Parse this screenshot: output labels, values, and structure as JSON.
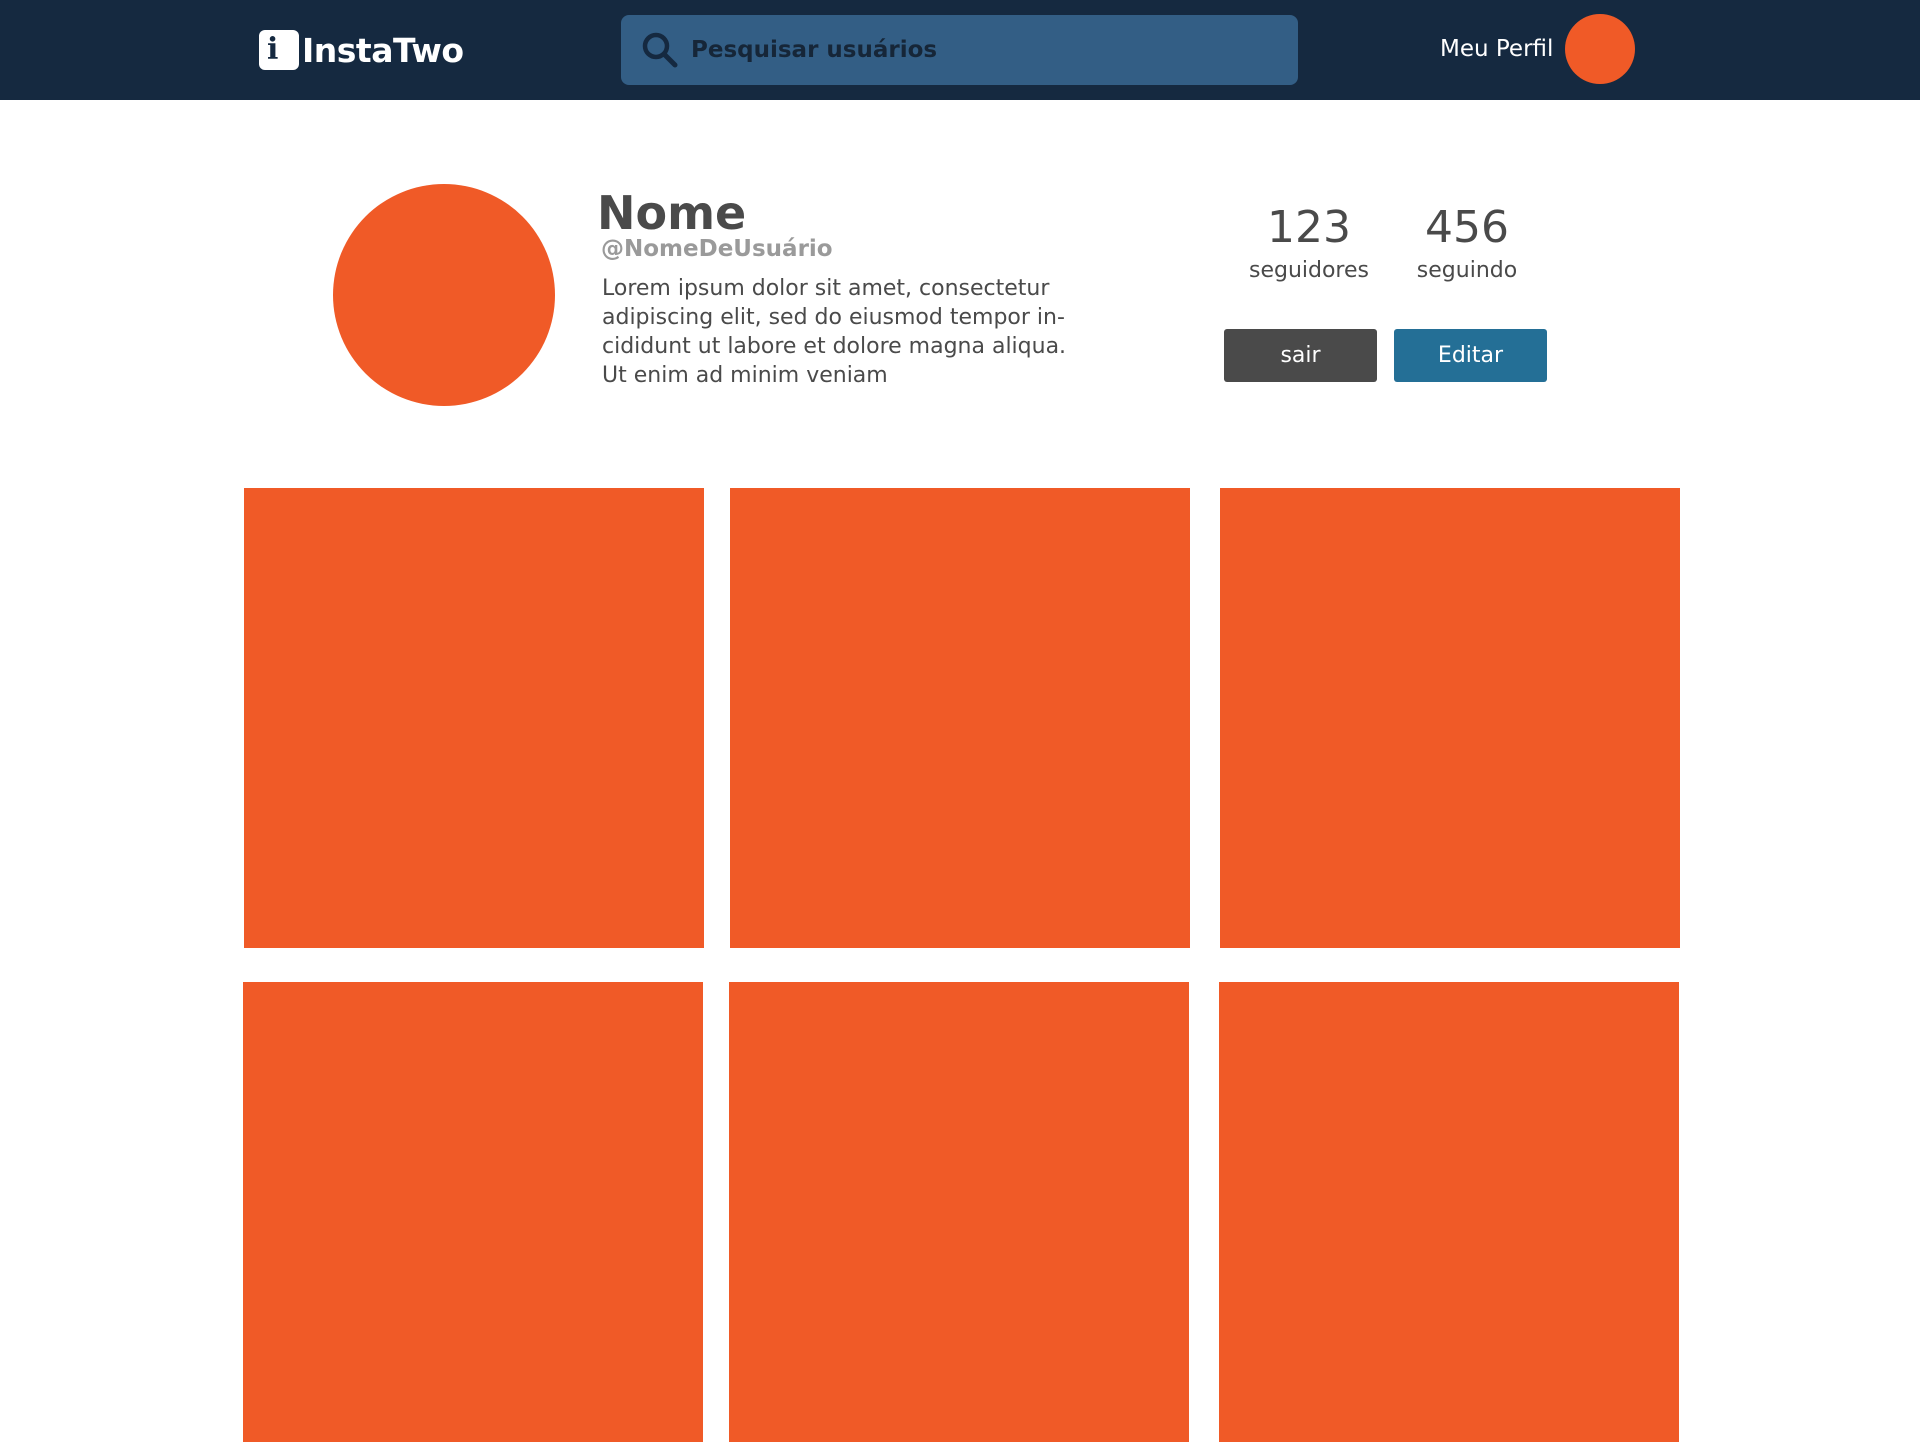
{
  "header": {
    "logo_mark": "i",
    "brand": "InstaTwo",
    "search_placeholder": "Pesquisar usuários",
    "profile_link_label": "Meu Perfil"
  },
  "profile": {
    "name": "Nome",
    "handle": "@NomeDeUsuário",
    "bio": "Lorem ipsum dolor sit amet, consectetur\nadipiscing elit, sed do eiusmod tempor in-\ncididunt ut labore et dolore magna aliqua.\nUt enim ad minim veniam",
    "followers_count": "123",
    "followers_label": "seguidores",
    "following_count": "456",
    "following_label": "seguindo"
  },
  "actions": {
    "logout_label": "sair",
    "edit_label": "Editar"
  },
  "posts": {
    "visible_count": 6
  },
  "colors": {
    "topbar": "#152940",
    "search_bg": "#335e85",
    "accent_orange": "#f05a27",
    "logout_button": "#4a4a4a",
    "edit_button": "#246f96",
    "text_dark": "#4a4a4a",
    "text_muted": "#9a9a9a"
  }
}
